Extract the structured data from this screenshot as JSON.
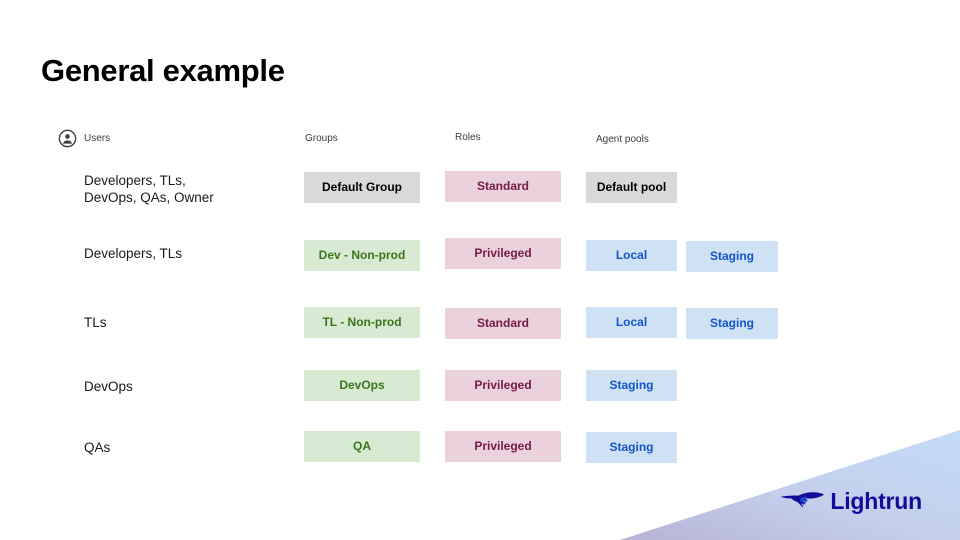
{
  "slide": {
    "title": "General example",
    "background": "#ffffff"
  },
  "brand": {
    "name": "Lightrun",
    "logo_icon": "lightrun-cheetah-logo",
    "text_color": "#140a9a",
    "gradient_from": "#b9b5d8",
    "gradient_to": "#bfd8f5"
  },
  "matrix": {
    "headers": {
      "users": "Users",
      "users_icon": "user-account-icon",
      "groups": "Groups",
      "roles": "Roles",
      "agent_pools": "Agent pools"
    },
    "colors": {
      "gray": "#d9d9d9",
      "gray_text": "#000000",
      "pink": "#ead1dc",
      "pink_text": "#741b47",
      "green": "#d9ead3",
      "green_text": "#38761d",
      "blue": "#cfe2f3",
      "blue_text": "#1155cc"
    },
    "rows": [
      {
        "users": "Developers, TLs,\nDevOps, QAs, Owner",
        "group": "Default Group",
        "role": "Standard",
        "pool1": "Default pool",
        "pool2": ""
      },
      {
        "users": "Developers, TLs",
        "group": "Dev - Non-prod",
        "role": "Privileged",
        "pool1": "Local",
        "pool2": "Staging"
      },
      {
        "users": "TLs",
        "group": "TL - Non-prod",
        "role": "Standard",
        "pool1": "Local",
        "pool2": "Staging"
      },
      {
        "users": "DevOps",
        "group": "DevOps",
        "role": "Privileged",
        "pool1": "Staging",
        "pool2": ""
      },
      {
        "users": "QAs",
        "group": "QA",
        "role": "Privileged",
        "pool1": "Staging",
        "pool2": ""
      }
    ]
  }
}
